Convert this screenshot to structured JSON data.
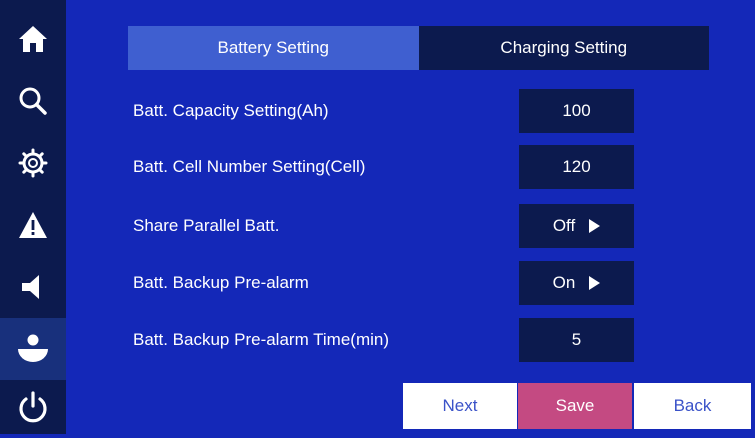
{
  "sidebar": {
    "items": [
      {
        "icon": "home-icon"
      },
      {
        "icon": "search-icon"
      },
      {
        "icon": "gear-icon"
      },
      {
        "icon": "warning-icon"
      },
      {
        "icon": "speaker-icon"
      },
      {
        "icon": "user-icon",
        "active": true
      },
      {
        "icon": "power-icon"
      }
    ]
  },
  "tabs": [
    {
      "label": "Battery Setting",
      "active": true
    },
    {
      "label": "Charging Setting",
      "active": false
    }
  ],
  "settings": [
    {
      "label": "Batt. Capacity Setting(Ah)",
      "value": "100",
      "has_arrow": false
    },
    {
      "label": "Batt. Cell Number Setting(Cell)",
      "value": "120",
      "has_arrow": false
    },
    {
      "label": "Share Parallel Batt.",
      "value": "Off",
      "has_arrow": true
    },
    {
      "label": "Batt. Backup Pre-alarm",
      "value": "On",
      "has_arrow": true
    },
    {
      "label": "Batt. Backup Pre-alarm Time(min)",
      "value": "5",
      "has_arrow": false
    }
  ],
  "buttons": {
    "next": "Next",
    "save": "Save",
    "back": "Back"
  },
  "colors": {
    "background": "#1428b8",
    "panel": "#0c1a4e",
    "active_tab": "#3f5fd0",
    "save_button": "#c44a82"
  }
}
